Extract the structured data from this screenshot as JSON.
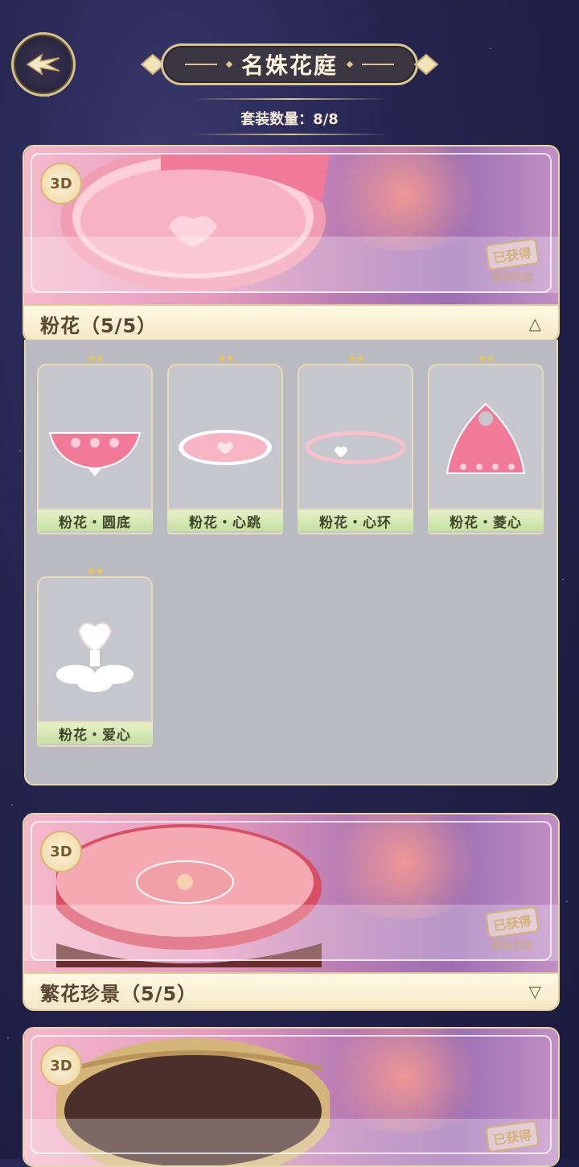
{
  "header": {
    "title": "名姝花庭",
    "count_label": "套装数量：8/8"
  },
  "suites": [
    {
      "name": "粉花（5/5）",
      "badge": "3D",
      "stamp": "已获得",
      "stamp_sub": "套装奖励",
      "expanded": true,
      "items": [
        {
          "name": "粉花・圆底",
          "stars": 2
        },
        {
          "name": "粉花・心跳",
          "stars": 2
        },
        {
          "name": "粉花・心环",
          "stars": 2
        },
        {
          "name": "粉花・菱心",
          "stars": 2
        },
        {
          "name": "粉花・爱心",
          "stars": 2
        }
      ]
    },
    {
      "name": "繁花珍景（5/5）",
      "badge": "3D",
      "stamp": "已获得",
      "stamp_sub": "套装奖励",
      "expanded": false
    },
    {
      "name": "",
      "badge": "3D",
      "stamp": "已获得"
    }
  ],
  "colors": {
    "accent_gold": "#d9c690",
    "item_label_green": "#c8e0a2",
    "panel_gray": "#babbc2"
  }
}
